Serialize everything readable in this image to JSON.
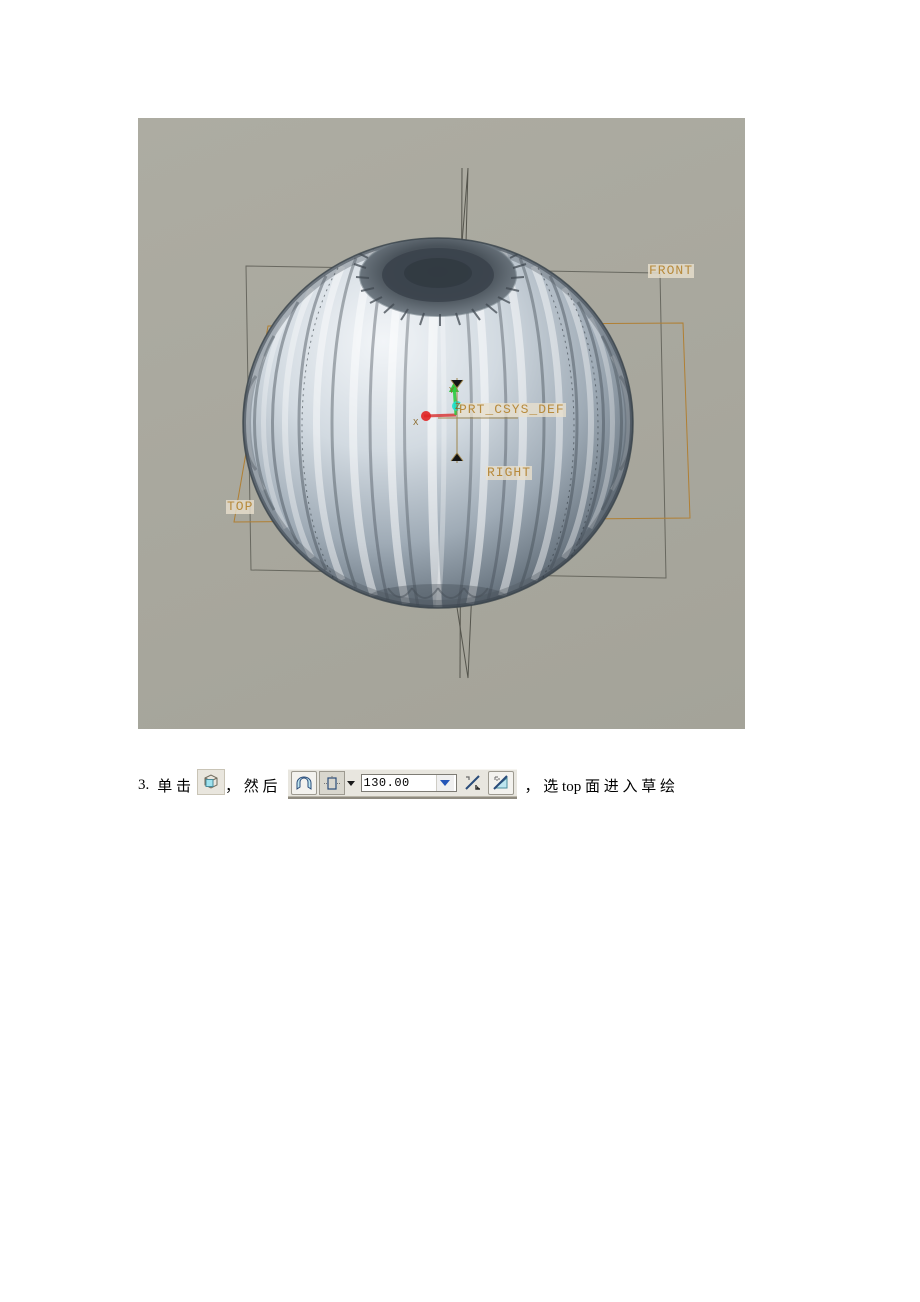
{
  "document": {
    "background_color": "#ffffff"
  },
  "figure": {
    "name": "pro-engineer-3d-viewport",
    "background_color": "#a9a89e",
    "model_description": "ribbed lantern sphere solid with dimpled top recess",
    "model_color_light": "#e6eaee",
    "model_color_mid": "#aab4bd",
    "model_color_dark": "#4d5760",
    "labels": {
      "front_plane": "FRONT",
      "top_plane": "TOP",
      "right_plane": "RIGHT",
      "coordinate_system": "PRT_CSYS_DEF"
    },
    "axis_letters": {
      "x": "X",
      "y": "Y",
      "z": "Z"
    },
    "colors": {
      "datum_plane_brown": "#b07f33",
      "datum_plane_gray": "#5a5a52",
      "label_text": "#b78a3c",
      "label_chip_bg": "#e9e0cd",
      "axis_x": "#e02020",
      "axis_y": "#2ecc2e",
      "axis_z": "#19e0c8"
    }
  },
  "instruction": {
    "step_number": "3.",
    "text_before_icon": "单 击",
    "text_after_icon": "， 然 后",
    "text_tail": "， 选  top  面 进 入 草 绘",
    "icons": {
      "revolve_icon": "revolve-tool-icon",
      "surface_icon": "surface-option-icon",
      "blind_depth_icon": "blind-depth-icon",
      "depth_dropdown_icon": "chevron-down-icon",
      "flip_direction_icon": "flip-direction-icon",
      "remove_material_icon": "remove-material-icon",
      "combo_arrow_icon": "combo-chevron-down-icon"
    },
    "depth_field": {
      "value": "130.00",
      "placeholder": "130.00"
    }
  }
}
